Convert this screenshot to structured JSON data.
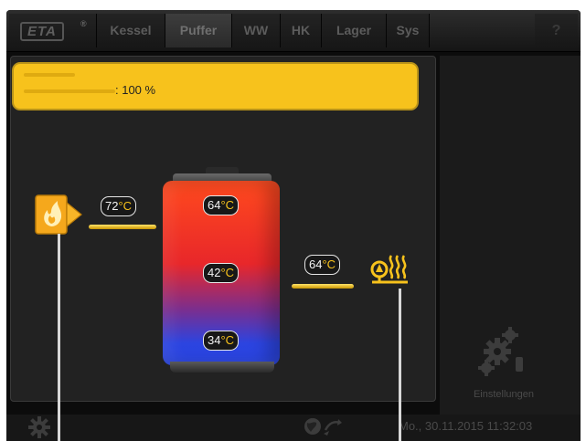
{
  "brand": {
    "logo": "ETA",
    "registered": "®"
  },
  "tabs": [
    {
      "label": "Kessel",
      "active": false
    },
    {
      "label": "Puffer",
      "active": true
    },
    {
      "label": "WW",
      "active": false
    },
    {
      "label": "HK",
      "active": false
    },
    {
      "label": "Lager",
      "active": false
    },
    {
      "label": "Sys",
      "active": false
    }
  ],
  "help": {
    "label": "?"
  },
  "banner": {
    "value": ": 100 %"
  },
  "temps": {
    "supply": {
      "value": "72",
      "unit": "°C"
    },
    "tank_top": {
      "value": "64",
      "unit": "°C"
    },
    "tank_middle": {
      "value": "42",
      "unit": "°C"
    },
    "tank_bottom": {
      "value": "34",
      "unit": "°C"
    },
    "consumer": {
      "value": "64",
      "unit": "°C"
    }
  },
  "settings": {
    "label": "Einstellungen"
  },
  "status": {
    "datetime": "Mo., 30.11.2015 11:32:03"
  },
  "icons": {
    "boiler": "boiler-flame-icon",
    "consumer": "heating-circuit-icon",
    "settings": "gears-icon",
    "status_gear": "gear-icon",
    "status_network": "globe-network-icon"
  },
  "colors": {
    "accent": "#f7c21c",
    "tank_hot": "#e8272a",
    "tank_cold": "#2a46e6"
  }
}
